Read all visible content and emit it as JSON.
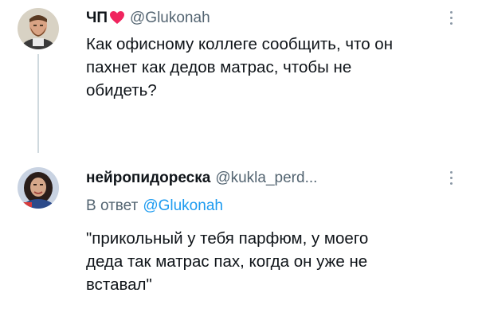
{
  "tweets": [
    {
      "display_name": "ЧП",
      "handle": "@Glukonah",
      "text": "Как офисному коллеге сообщить, что он\nпахнет как дедов матрас, чтобы не\nобидеть?",
      "heart_icon": "red-heart-icon",
      "avatar_icon": "bearded-man-avatar"
    },
    {
      "display_name": "нейропидореска",
      "handle": "@kukla_perd...",
      "reply_label": "В ответ",
      "reply_mention": "@Glukonah",
      "text": "\"прикольный у тебя парфюм, у моего\nдеда так матрас пах, когда он уже не\nвставал\"",
      "avatar_icon": "woman-dark-hair-avatar"
    }
  ],
  "colors": {
    "text": "#0f1419",
    "secondary": "#536471",
    "accent": "#1d9bf0",
    "heart": "#f91880",
    "thread_line": "#cfd9de"
  }
}
